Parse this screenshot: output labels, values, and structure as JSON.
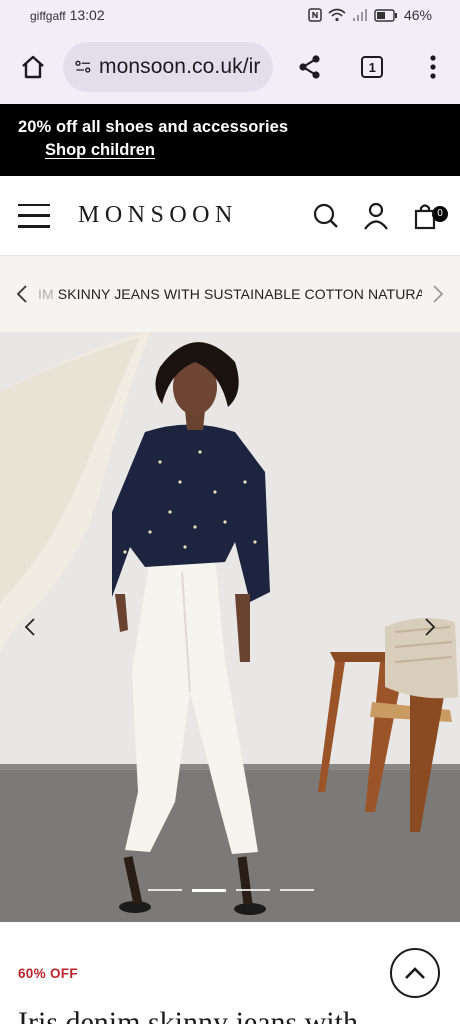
{
  "status_bar": {
    "carrier": "giffgaff",
    "time": "13:02",
    "battery": "46%"
  },
  "browser": {
    "url": "monsoon.co.uk/ir",
    "tab_count": "1",
    "icons": [
      "home-icon",
      "site-info-icon",
      "share-icon",
      "tabs-icon",
      "more-icon"
    ]
  },
  "promo": {
    "line1": "20% off all shoes and accessories",
    "link": "Shop children"
  },
  "header": {
    "logo": "MONSOON",
    "bag_count": "0",
    "icons": [
      "menu-icon",
      "search-icon",
      "account-icon",
      "bag-icon"
    ]
  },
  "breadcrumb": {
    "faded_prefix": "IM ",
    "text": "SKINNY JEANS WITH SUSTAINABLE COTTON NATURAL"
  },
  "gallery": {
    "image_count": 4,
    "active_index": 1
  },
  "product": {
    "discount": "60% OFF",
    "title": "Iris denim skinny jeans with"
  },
  "colors": {
    "promo_bg": "#000000",
    "discount_red": "#b8252d",
    "browser_bg": "#f1eef7"
  }
}
